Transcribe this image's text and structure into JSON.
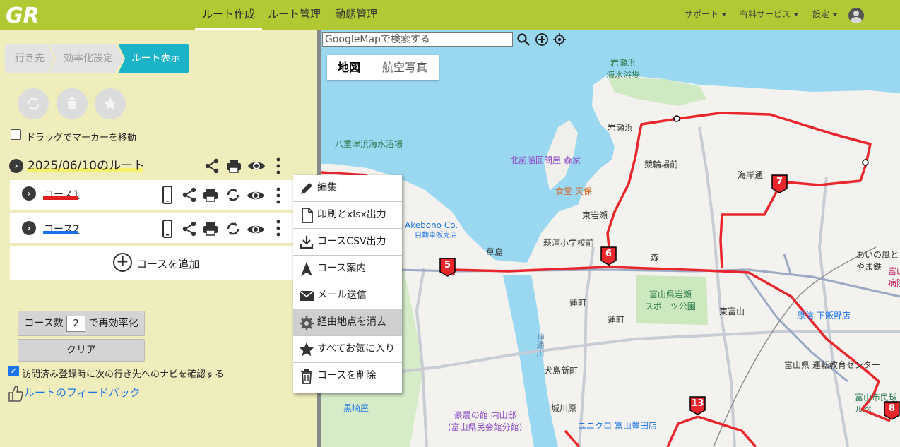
{
  "header": {
    "logo": "GR",
    "nav": [
      "ルート作成",
      "ルート管理",
      "動態管理"
    ],
    "menus": [
      "サポート",
      "有料サービス",
      "設定"
    ]
  },
  "steps": [
    "行き先",
    "効率化設定",
    "ルート表示"
  ],
  "drag_label": "ドラッグでマーカーを移動",
  "route_title": "2025/06/10のルート",
  "courses": [
    {
      "name": "コース1",
      "color": "#e02020"
    },
    {
      "name": "コース2",
      "color": "#1a73e8"
    }
  ],
  "add_course": "コースを追加",
  "reoptimize": {
    "prefix": "コース数",
    "count": "2",
    "suffix": "で再効率化"
  },
  "clear": "クリア",
  "visit_confirm": "訪問済み登録時に次の行き先へのナビを確認する",
  "feedback": "ルートのフィードバック",
  "context_menu": [
    {
      "label": "編集",
      "icon": "pencil-icon"
    },
    {
      "label": "印刷とxlsx出力",
      "icon": "document-icon"
    },
    {
      "label": "コースCSV出力",
      "icon": "download-icon"
    },
    {
      "label": "コース案内",
      "icon": "navigation-icon"
    },
    {
      "label": "メール送信",
      "icon": "mail-icon"
    },
    {
      "label": "経由地点を消去",
      "icon": "gear-icon"
    },
    {
      "label": "すべてお気に入り",
      "icon": "star-icon"
    },
    {
      "label": "コースを削除",
      "icon": "trash-icon"
    }
  ],
  "map": {
    "search_placeholder": "GoogleMapで検索する",
    "types": [
      "地図",
      "航空写真"
    ],
    "markers": [
      "5",
      "6",
      "7",
      "13",
      "8"
    ],
    "labels": {
      "iwasehama_beach": "岩瀬浜\n海水浴場",
      "hachiman_beach": "八重津浜海水浴場",
      "morike": "北前船回問屋 森家",
      "iwasehama": "岩瀬浜",
      "keirin": "競輪場前",
      "shokudo": "食堂 天保",
      "higashi_iwase": "東岩瀬",
      "kaigan": "海岸通",
      "akebono": "Akebono Co.",
      "akebono_sub": "自動車販売店",
      "kusajima": "草島",
      "hagiura": "萩浦小学校前",
      "mori": "森",
      "park": "富山県岩瀬\nスポーツ公園",
      "higashi_toyama": "東富山",
      "harashin": "原信 下飯野店",
      "hasunomachi": "蓮町",
      "hasunomachi2": "蓮町",
      "unten": "富山県 運転教育センター",
      "inujima": "犬島新町",
      "jokawara": "城川原",
      "kurosakiya": "黒崎屋",
      "uchiyama": "豪農の館 内山邸\n(富山県民会館分館)",
      "uniqlo": "ユニクロ 富山豊田店",
      "ainokaze": "あいの風とやま鉄",
      "hospital": "富山\n病院",
      "minkyo": "富山市民球\nルペ",
      "jinzu": "神通川"
    }
  },
  "colors": {
    "route": "#e8262c",
    "accent": "#1ab3c8",
    "header": "#b2c934",
    "panel": "#f0edbc"
  }
}
